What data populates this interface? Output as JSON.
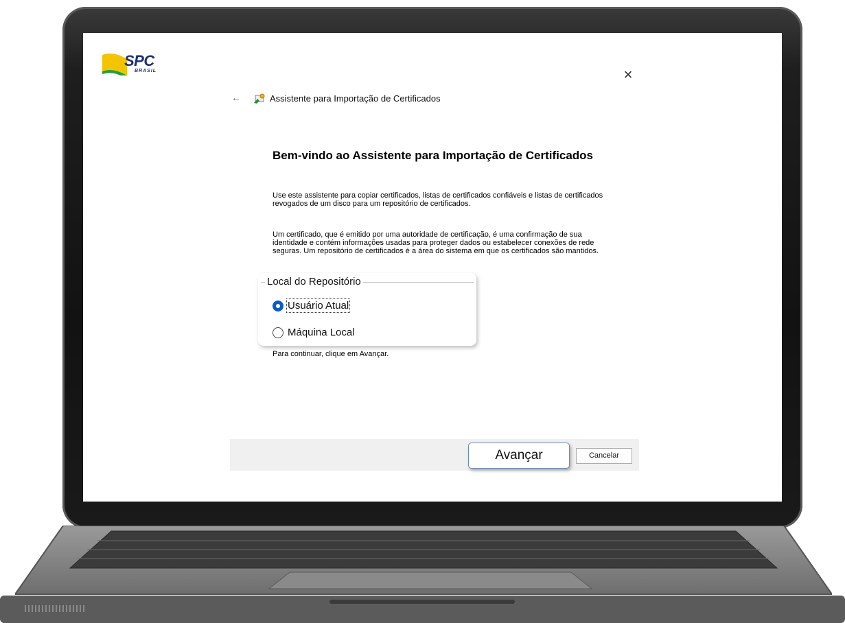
{
  "brand": {
    "name": "SPC",
    "sub": "BRASIL"
  },
  "window": {
    "close_glyph": "×",
    "back_glyph": "←",
    "title": "Assistente para Importação de Certificados"
  },
  "content": {
    "heading": "Bem-vindo ao Assistente para Importação de Certificados",
    "paragraph1": "Use este assistente para copiar certificados, listas de certificados confiáveis e listas de certificados revogados de um disco para um repositório de certificados.",
    "paragraph2": "Um certificado, que é emitido por uma autoridade de certificação, é uma confirmação de sua identidade e contém informações usadas para proteger dados ou estabelecer conexões de rede seguras. Um repositório de certificados é a área do sistema em que os certificados são mantidos.",
    "group_label": "Local do Repositório",
    "options": [
      {
        "label": "Usuário Atual",
        "selected": true
      },
      {
        "label": "Máquina Local",
        "selected": false
      }
    ],
    "hint": "Para continuar, clique em Avançar."
  },
  "buttons": {
    "next_label": "Avançar",
    "cancel_label": "Cancelar"
  },
  "colors": {
    "accent": "#0b5cc7",
    "brand_blue": "#1c2f7a",
    "brand_yellow": "#f2c500",
    "brand_green": "#2a9d3a"
  },
  "icons": {
    "wizard": "certificate-wizard-icon",
    "back": "back-arrow-icon",
    "close": "close-icon"
  }
}
